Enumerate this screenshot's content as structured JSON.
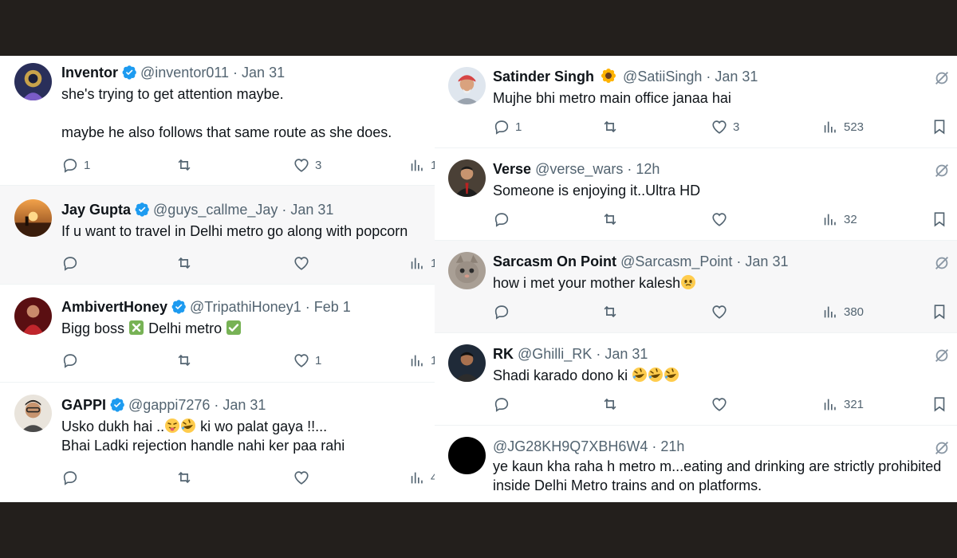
{
  "left_tweets": [
    {
      "name": "Inventor",
      "verified": true,
      "handle": "@inventor011",
      "date": "· Jan 31",
      "lines": [
        "she's trying to get attention maybe.",
        "",
        "maybe he also follows that same route as she does."
      ],
      "replies": "1",
      "likes": "3",
      "views": "1"
    },
    {
      "name": "Jay Gupta",
      "verified": true,
      "handle": "@guys_callme_Jay",
      "date": "· Jan 31",
      "lines": [
        "If u want to travel in Delhi metro go along with popcorn"
      ],
      "replies": "",
      "likes": "",
      "views": "1"
    },
    {
      "name": "AmbivertHoney",
      "verified": true,
      "handle": "@TripathiHoney1",
      "date": "· Feb 1",
      "text_a": "Bigg boss",
      "text_b": "Delhi metro",
      "replies": "",
      "likes": "1",
      "views": "1"
    },
    {
      "name": "GAPPI",
      "verified": true,
      "handle": "@gappi7276",
      "date": "· Jan 31",
      "text_a": "Usko dukh hai ..",
      "text_b": "ki wo palat gaya !!...",
      "line2": "Bhai Ladki rejection handle nahi ker paa rahi",
      "replies": "",
      "likes": "",
      "views": "4"
    }
  ],
  "right_tweets": [
    {
      "name": "Satinder Singh",
      "handle": "@SatiiSingh",
      "date": "· Jan 31",
      "text": "Mujhe bhi metro main office janaa hai",
      "replies": "1",
      "likes": "3",
      "views": "523"
    },
    {
      "name": "Verse",
      "handle": "@verse_wars",
      "date": "· 12h",
      "text": "Someone is enjoying it..Ultra HD",
      "replies": "",
      "likes": "",
      "views": "32"
    },
    {
      "name": "Sarcasm On Point",
      "handle": "@Sarcasm_Point",
      "date": "· Jan 31",
      "text": "how i met your mother kalesh",
      "replies": "",
      "likes": "",
      "views": "380"
    },
    {
      "name": "RK",
      "handle": "@Ghilli_RK",
      "date": "· Jan 31",
      "text": "Shadi karado dono ki",
      "replies": "",
      "likes": "",
      "views": "321"
    },
    {
      "name": "",
      "handle": "@JG28KH9Q7XBH6W4",
      "date": "· 21h",
      "line1": "ye kaun kha raha h metro m...eating and drinking are strictly prohibited",
      "line2": "inside Delhi Metro trains and on platforms."
    }
  ],
  "icons": {
    "reply": "speech-bubble-icon",
    "retweet": "retweet-arrows-icon",
    "like": "heart-icon",
    "views": "bar-chart-icon",
    "bookmark": "bookmark-icon",
    "grok": "slashed-circle-icon",
    "verified": "verified-badge-icon"
  },
  "colors": {
    "verified": "#1d9bf0",
    "text": "#0f1419",
    "muted": "#536471",
    "frame": "#231f1c"
  }
}
